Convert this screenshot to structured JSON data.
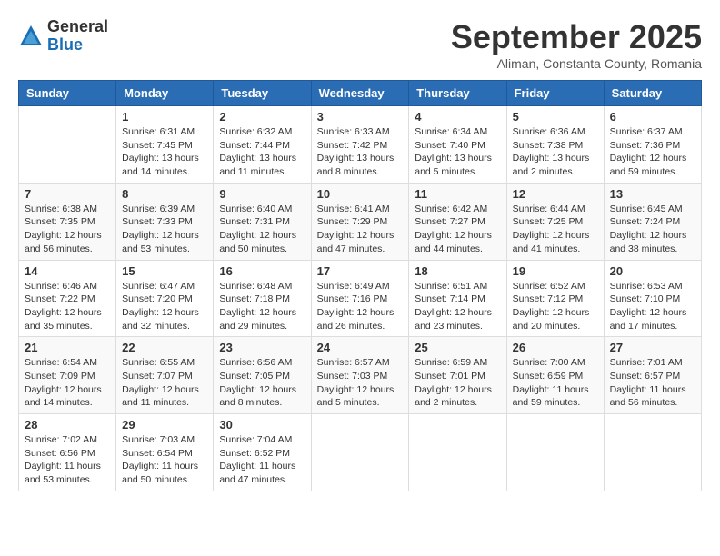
{
  "logo": {
    "general": "General",
    "blue": "Blue"
  },
  "title": "September 2025",
  "location": "Aliman, Constanta County, Romania",
  "weekdays": [
    "Sunday",
    "Monday",
    "Tuesday",
    "Wednesday",
    "Thursday",
    "Friday",
    "Saturday"
  ],
  "weeks": [
    [
      {
        "day": "",
        "info": ""
      },
      {
        "day": "1",
        "info": "Sunrise: 6:31 AM\nSunset: 7:45 PM\nDaylight: 13 hours\nand 14 minutes."
      },
      {
        "day": "2",
        "info": "Sunrise: 6:32 AM\nSunset: 7:44 PM\nDaylight: 13 hours\nand 11 minutes."
      },
      {
        "day": "3",
        "info": "Sunrise: 6:33 AM\nSunset: 7:42 PM\nDaylight: 13 hours\nand 8 minutes."
      },
      {
        "day": "4",
        "info": "Sunrise: 6:34 AM\nSunset: 7:40 PM\nDaylight: 13 hours\nand 5 minutes."
      },
      {
        "day": "5",
        "info": "Sunrise: 6:36 AM\nSunset: 7:38 PM\nDaylight: 13 hours\nand 2 minutes."
      },
      {
        "day": "6",
        "info": "Sunrise: 6:37 AM\nSunset: 7:36 PM\nDaylight: 12 hours\nand 59 minutes."
      }
    ],
    [
      {
        "day": "7",
        "info": "Sunrise: 6:38 AM\nSunset: 7:35 PM\nDaylight: 12 hours\nand 56 minutes."
      },
      {
        "day": "8",
        "info": "Sunrise: 6:39 AM\nSunset: 7:33 PM\nDaylight: 12 hours\nand 53 minutes."
      },
      {
        "day": "9",
        "info": "Sunrise: 6:40 AM\nSunset: 7:31 PM\nDaylight: 12 hours\nand 50 minutes."
      },
      {
        "day": "10",
        "info": "Sunrise: 6:41 AM\nSunset: 7:29 PM\nDaylight: 12 hours\nand 47 minutes."
      },
      {
        "day": "11",
        "info": "Sunrise: 6:42 AM\nSunset: 7:27 PM\nDaylight: 12 hours\nand 44 minutes."
      },
      {
        "day": "12",
        "info": "Sunrise: 6:44 AM\nSunset: 7:25 PM\nDaylight: 12 hours\nand 41 minutes."
      },
      {
        "day": "13",
        "info": "Sunrise: 6:45 AM\nSunset: 7:24 PM\nDaylight: 12 hours\nand 38 minutes."
      }
    ],
    [
      {
        "day": "14",
        "info": "Sunrise: 6:46 AM\nSunset: 7:22 PM\nDaylight: 12 hours\nand 35 minutes."
      },
      {
        "day": "15",
        "info": "Sunrise: 6:47 AM\nSunset: 7:20 PM\nDaylight: 12 hours\nand 32 minutes."
      },
      {
        "day": "16",
        "info": "Sunrise: 6:48 AM\nSunset: 7:18 PM\nDaylight: 12 hours\nand 29 minutes."
      },
      {
        "day": "17",
        "info": "Sunrise: 6:49 AM\nSunset: 7:16 PM\nDaylight: 12 hours\nand 26 minutes."
      },
      {
        "day": "18",
        "info": "Sunrise: 6:51 AM\nSunset: 7:14 PM\nDaylight: 12 hours\nand 23 minutes."
      },
      {
        "day": "19",
        "info": "Sunrise: 6:52 AM\nSunset: 7:12 PM\nDaylight: 12 hours\nand 20 minutes."
      },
      {
        "day": "20",
        "info": "Sunrise: 6:53 AM\nSunset: 7:10 PM\nDaylight: 12 hours\nand 17 minutes."
      }
    ],
    [
      {
        "day": "21",
        "info": "Sunrise: 6:54 AM\nSunset: 7:09 PM\nDaylight: 12 hours\nand 14 minutes."
      },
      {
        "day": "22",
        "info": "Sunrise: 6:55 AM\nSunset: 7:07 PM\nDaylight: 12 hours\nand 11 minutes."
      },
      {
        "day": "23",
        "info": "Sunrise: 6:56 AM\nSunset: 7:05 PM\nDaylight: 12 hours\nand 8 minutes."
      },
      {
        "day": "24",
        "info": "Sunrise: 6:57 AM\nSunset: 7:03 PM\nDaylight: 12 hours\nand 5 minutes."
      },
      {
        "day": "25",
        "info": "Sunrise: 6:59 AM\nSunset: 7:01 PM\nDaylight: 12 hours\nand 2 minutes."
      },
      {
        "day": "26",
        "info": "Sunrise: 7:00 AM\nSunset: 6:59 PM\nDaylight: 11 hours\nand 59 minutes."
      },
      {
        "day": "27",
        "info": "Sunrise: 7:01 AM\nSunset: 6:57 PM\nDaylight: 11 hours\nand 56 minutes."
      }
    ],
    [
      {
        "day": "28",
        "info": "Sunrise: 7:02 AM\nSunset: 6:56 PM\nDaylight: 11 hours\nand 53 minutes."
      },
      {
        "day": "29",
        "info": "Sunrise: 7:03 AM\nSunset: 6:54 PM\nDaylight: 11 hours\nand 50 minutes."
      },
      {
        "day": "30",
        "info": "Sunrise: 7:04 AM\nSunset: 6:52 PM\nDaylight: 11 hours\nand 47 minutes."
      },
      {
        "day": "",
        "info": ""
      },
      {
        "day": "",
        "info": ""
      },
      {
        "day": "",
        "info": ""
      },
      {
        "day": "",
        "info": ""
      }
    ]
  ]
}
